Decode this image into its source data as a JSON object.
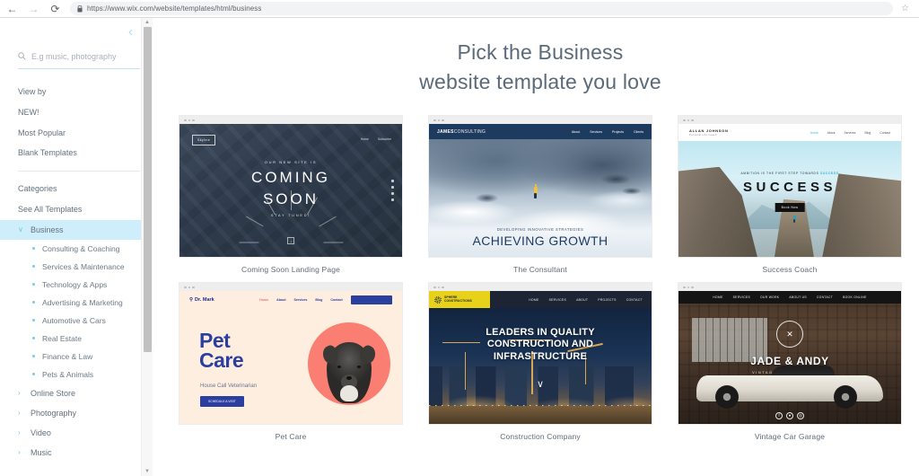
{
  "browser": {
    "url": "https://www.wix.com/website/templates/html/business",
    "back_icon": "back-arrow-icon",
    "forward_icon": "forward-arrow-icon",
    "reload_icon": "reload-icon",
    "lock_icon": "lock-icon",
    "star_glyph": "☆"
  },
  "sidebar": {
    "collapse_glyph": "‹",
    "search": {
      "placeholder": "E.g music, photography",
      "value": ""
    },
    "links": [
      {
        "label": "View by"
      },
      {
        "label": "NEW!"
      },
      {
        "label": "Most Popular"
      },
      {
        "label": "Blank Templates"
      }
    ],
    "categories_label": "Categories",
    "see_all_label": "See All Templates",
    "business": {
      "label": "Business",
      "expanded": true,
      "chevron": "∨",
      "highlight": "#cfeefb",
      "children": [
        "Consulting & Coaching",
        "Services & Maintenance",
        "Technology & Apps",
        "Advertising & Marketing",
        "Automotive & Cars",
        "Real Estate",
        "Finance & Law",
        "Pets & Animals"
      ]
    },
    "collapsed_categories": [
      {
        "label": "Online Store",
        "chevron": "›"
      },
      {
        "label": "Photography",
        "chevron": "›"
      },
      {
        "label": "Video",
        "chevron": "›"
      },
      {
        "label": "Music",
        "chevron": "›"
      }
    ]
  },
  "main": {
    "title_line1": "Pick the Business",
    "title_line2": "website template you love",
    "templates": [
      {
        "caption": "Coming Soon Landing Page",
        "logo": "Skyline",
        "nav": [
          "Home",
          "Subscribe"
        ],
        "kicker": "OUR NEW SITE IS",
        "headline_1": "COMING",
        "headline_2": "SOON",
        "subline": "STAY TUNED!",
        "arrow": "↓"
      },
      {
        "caption": "The Consultant",
        "logo_bold": "JAMES",
        "logo_light": "CONSULTING",
        "nav": [
          "About",
          "Services",
          "Projects",
          "Clients"
        ],
        "kicker": "DEVELOPING INNOVATIVE STRATEGIES",
        "headline": "ACHIEVING GROWTH"
      },
      {
        "caption": "Success Coach",
        "logo": "ALLAN JOHNSON",
        "logo_sub": "Personal Life Coach",
        "nav": [
          "Home",
          "About",
          "Services",
          "Blog",
          "Contact"
        ],
        "kicker_pre": "AMBITION IS THE FIRST STEP TOWARDS ",
        "kicker_em": "SUCCESS",
        "headline": "SUCCESS",
        "button": "Book Now"
      },
      {
        "caption": "Pet Care",
        "logo": "Dr. Mark",
        "logo_icon": "pin-icon",
        "nav": [
          "Home",
          "About",
          "Services",
          "Blog",
          "Contact"
        ],
        "cta": "CALL 123-456-7890",
        "headline_1": "Pet",
        "headline_2": "Care",
        "subline": "House Call Veterinarian",
        "button": "SCHEDULE A VISIT"
      },
      {
        "caption": "Construction Company",
        "logo_1": "SPHERE",
        "logo_2": "CONSTRUCTIONS",
        "nav": [
          "HOME",
          "SERVICES",
          "ABOUT",
          "PROJECTS",
          "CONTACT"
        ],
        "headline_1": "LEADERS IN QUALITY",
        "headline_2": "CONSTRUCTION AND",
        "headline_3": "INFRASTRUCTURE",
        "chevron": "∨"
      },
      {
        "caption": "Vintage Car Garage",
        "nav": [
          "HOME",
          "SERVICES",
          "OUR WORK",
          "ABOUT US",
          "CONTACT",
          "BOOK ONLINE"
        ],
        "emblem": "✕",
        "title": "JADE & ANDY",
        "subtitle": "VINTAGE CAR SPECIALIST",
        "social": [
          "f",
          "●",
          "◎"
        ]
      }
    ]
  }
}
